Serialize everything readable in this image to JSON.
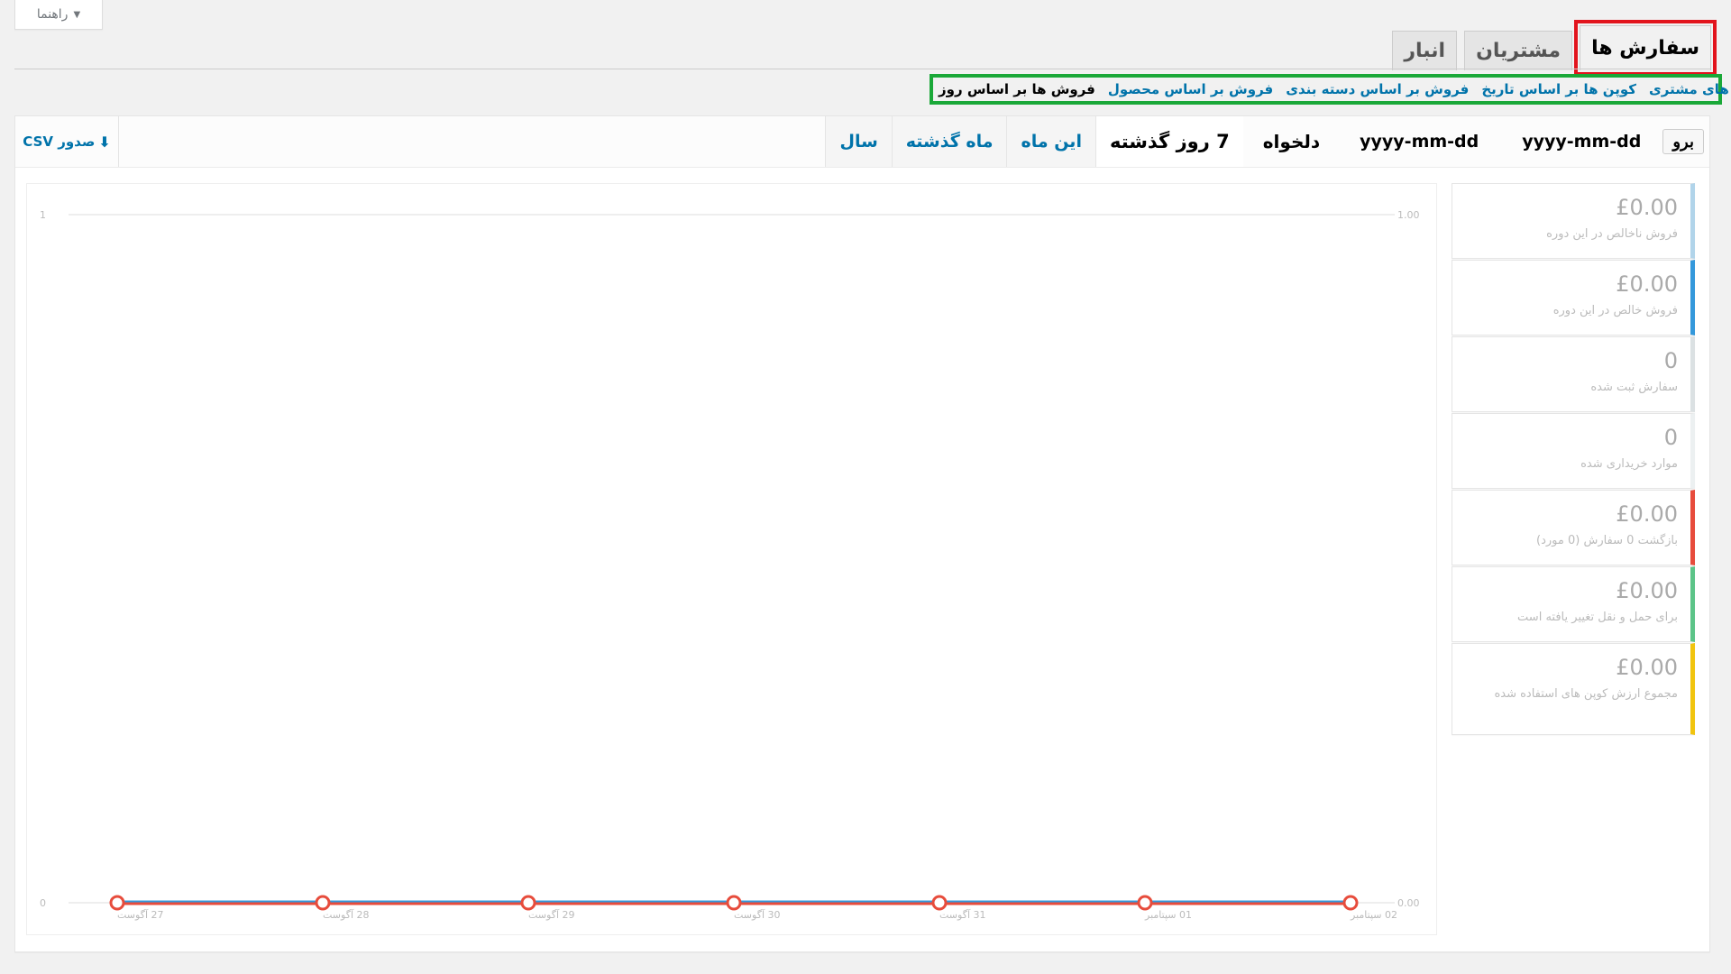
{
  "help": {
    "label": "راهنما"
  },
  "nav": {
    "tabs": [
      {
        "label": "سفارش ها",
        "active": true,
        "highlighted": true
      },
      {
        "label": "مشتریان",
        "active": false
      },
      {
        "label": "انبار",
        "active": false
      }
    ]
  },
  "subnav": {
    "items": [
      {
        "label": "فروش ها بر اساس روز",
        "current": true
      },
      {
        "label": "فروش بر اساس محصول"
      },
      {
        "label": "فروش بر اساس دسته بندی"
      },
      {
        "label": "کوپن ها بر اساس تاریخ"
      },
      {
        "label": "دانلود های مشتری"
      }
    ]
  },
  "ranges": {
    "year": "سال",
    "last_month": "ماه گذشته",
    "this_month": "این ماه",
    "last_7_days": "7 روز گذشته",
    "custom": "دلخواه",
    "start_placeholder": "yyyy-mm-dd",
    "end_placeholder": "yyyy-mm-dd",
    "go": "برو"
  },
  "export": {
    "label": "صدور CSV"
  },
  "legend": [
    {
      "value": "£0.00",
      "label": "فروش ناخالص در این دوره",
      "color": "#b1d4ea"
    },
    {
      "value": "£0.00",
      "label": "فروش خالص در این دوره",
      "color": "#3498db"
    },
    {
      "value": "0",
      "label": "سفارش ثبت شده",
      "color": "#dbe1e3"
    },
    {
      "value": "0",
      "label": "موارد خریداری شده",
      "color": "#ecf0f1"
    },
    {
      "value": "£0.00",
      "label": "بازگشت 0 سفارش (0 مورد)",
      "color": "#e74c3c"
    },
    {
      "value": "£0.00",
      "label": "برای حمل و نقل تغییر یافته است",
      "color": "#5cc488"
    },
    {
      "value": "£0.00",
      "label": "مجموع ارزش کوپن های استفاده شده",
      "color": "#f1c40f"
    }
  ],
  "chart_data": {
    "type": "line",
    "categories": [
      "27 آگوست",
      "28 آگوست",
      "29 آگوست",
      "30 آگوست",
      "31 آگوست",
      "01 سپتامبر",
      "02 سپتامبر"
    ],
    "series": [
      {
        "name": "فروش ناخالص در این دوره",
        "values": [
          0,
          0,
          0,
          0,
          0,
          0,
          0
        ],
        "color": "#3498db"
      },
      {
        "name": "بازگشت 0 سفارش (0 مورد)",
        "values": [
          0,
          0,
          0,
          0,
          0,
          0,
          0
        ],
        "color": "#e74c3c"
      }
    ],
    "y_left": {
      "ticks": [
        "0",
        "1"
      ],
      "ylim": [
        0,
        1
      ]
    },
    "y_right": {
      "ticks": [
        "0.00",
        "1.00"
      ]
    },
    "grid": true
  }
}
